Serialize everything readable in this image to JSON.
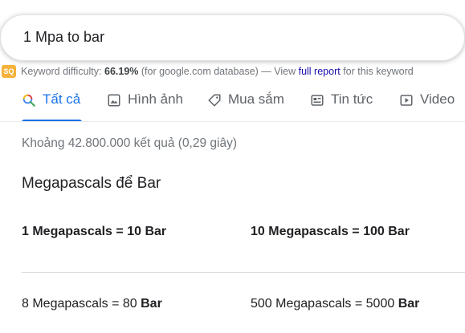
{
  "search": {
    "query": "1 Mpa to bar"
  },
  "keyword_bar": {
    "logo_text": "SQ",
    "label": "Keyword difficulty:",
    "difficulty": "66.19%",
    "source": "(for google.com database) — View",
    "link": "full report",
    "suffix": "for this keyword"
  },
  "tabs": [
    {
      "label": "Tất cả",
      "icon": "search-icon",
      "active": true
    },
    {
      "label": "Hình ảnh",
      "icon": "image-icon",
      "active": false
    },
    {
      "label": "Mua sắm",
      "icon": "tag-icon",
      "active": false
    },
    {
      "label": "Tin tức",
      "icon": "news-icon",
      "active": false
    },
    {
      "label": "Video",
      "icon": "play-icon",
      "active": false
    }
  ],
  "result_stats": "Khoảng 42.800.000 kết quả (0,29 giây)",
  "conversions": {
    "title": "Megapascals để Bar",
    "rows": [
      {
        "left_value": "1 Megapascals = 10",
        "unit": "Bar"
      },
      {
        "left_value": "10 Megapascals = 100",
        "unit": "Bar"
      },
      {
        "left_value": "8 Megapascals = 80",
        "unit": "Bar"
      },
      {
        "left_value": "500 Megapascals = 5000",
        "unit": "Bar"
      }
    ]
  },
  "colors": {
    "accent": "#1a73e8",
    "link": "#1a0dab",
    "muted": "#70757a"
  }
}
